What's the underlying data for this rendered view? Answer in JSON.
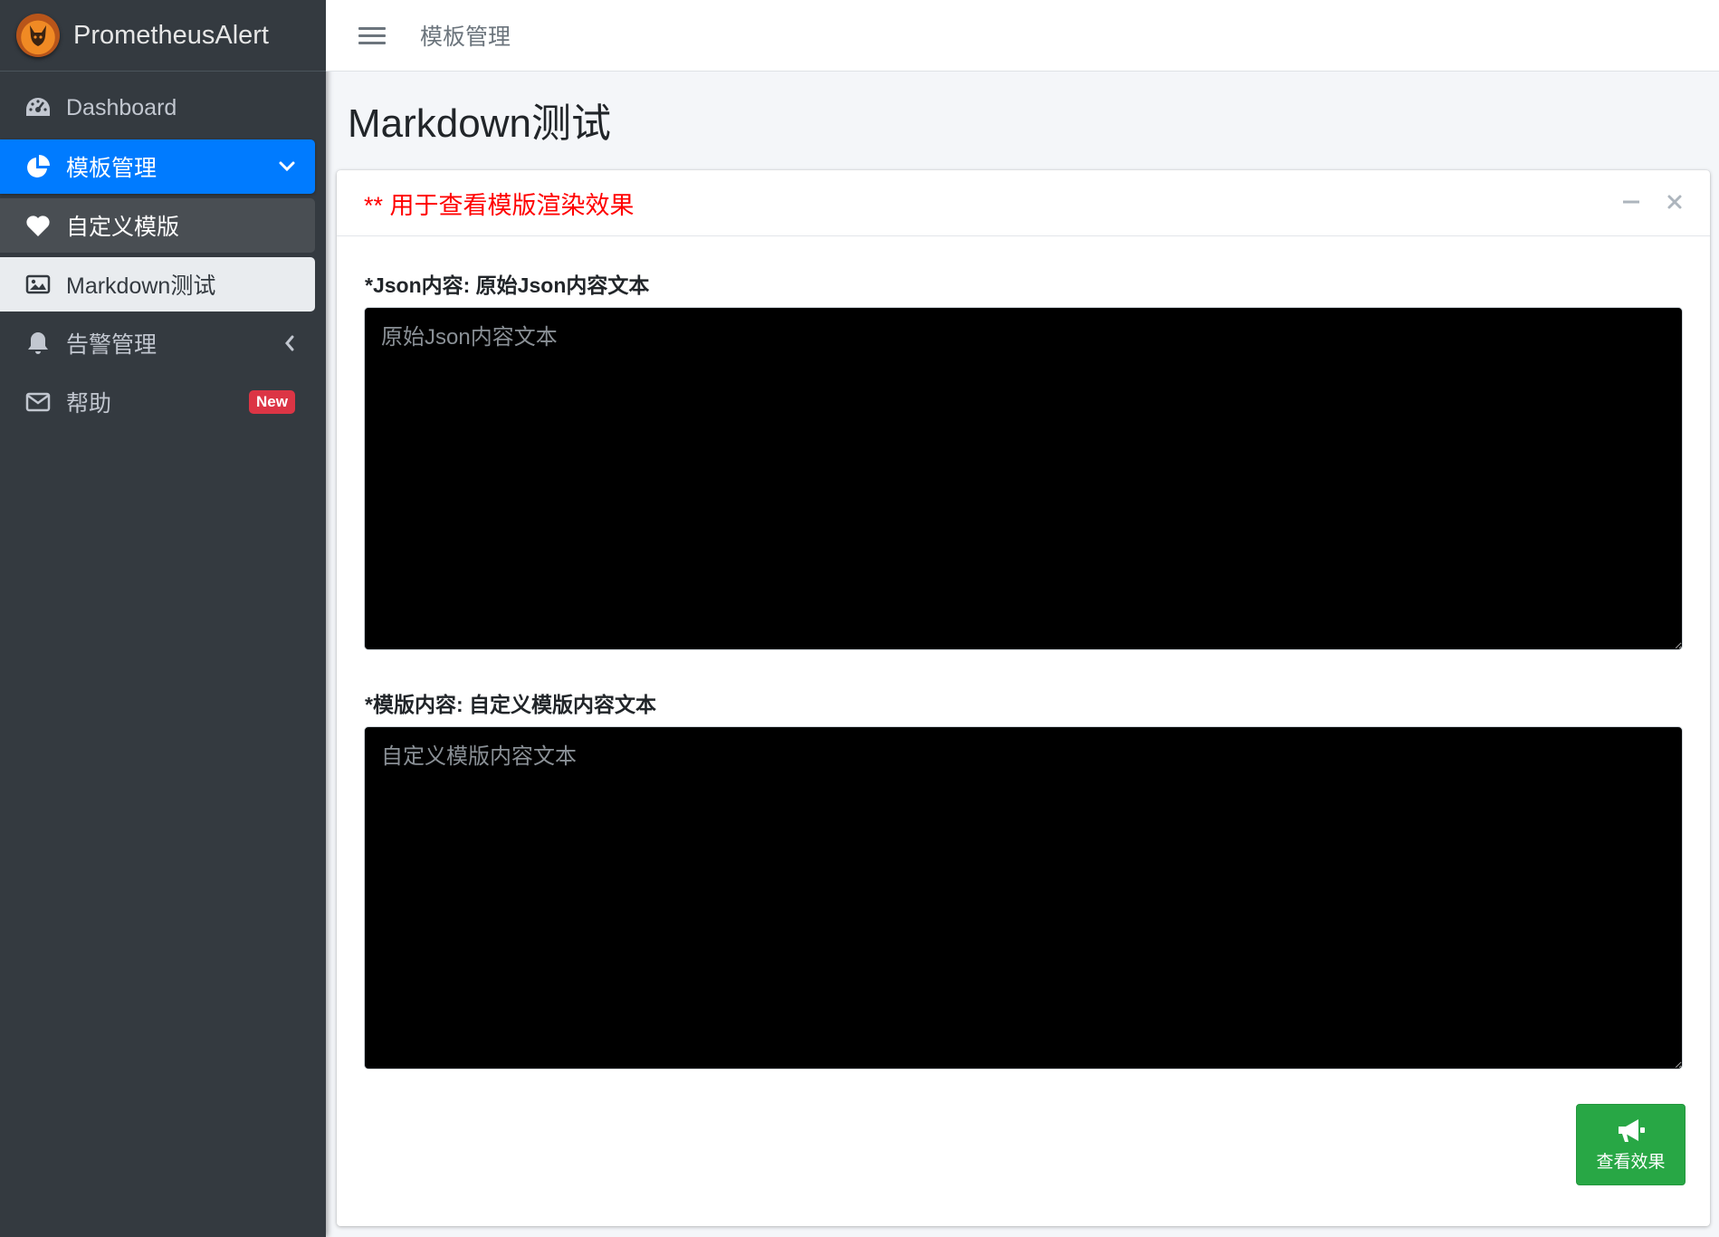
{
  "brand": {
    "name": "PrometheusAlert"
  },
  "sidebar": {
    "items": [
      {
        "label": "Dashboard",
        "icon": "tachometer-icon"
      },
      {
        "label": "模板管理",
        "icon": "pie-chart-icon",
        "state": "active-expanded"
      },
      {
        "label": "自定义模版",
        "icon": "heart-icon",
        "state": "submenu"
      },
      {
        "label": "Markdown测试",
        "icon": "image-icon",
        "state": "submenu-selected"
      },
      {
        "label": "告警管理",
        "icon": "bell-icon",
        "state": "collapsed"
      },
      {
        "label": "帮助",
        "icon": "envelope-icon",
        "badge": "New"
      }
    ]
  },
  "topbar": {
    "link": "模板管理"
  },
  "page": {
    "title": "Markdown测试"
  },
  "card": {
    "title": "** 用于查看模版渲染效果",
    "json_label": "*Json内容: 原始Json内容文本",
    "json_placeholder": "原始Json内容文本",
    "json_value": "",
    "tpl_label": "*模版内容: 自定义模版内容文本",
    "tpl_placeholder": "自定义模版内容文本",
    "tpl_value": "",
    "submit_label": "查看效果"
  },
  "colors": {
    "accent": "#007bff",
    "sidebar_bg": "#343a40",
    "success": "#28a745",
    "danger": "#dc3545",
    "title_red": "#ff0000"
  }
}
